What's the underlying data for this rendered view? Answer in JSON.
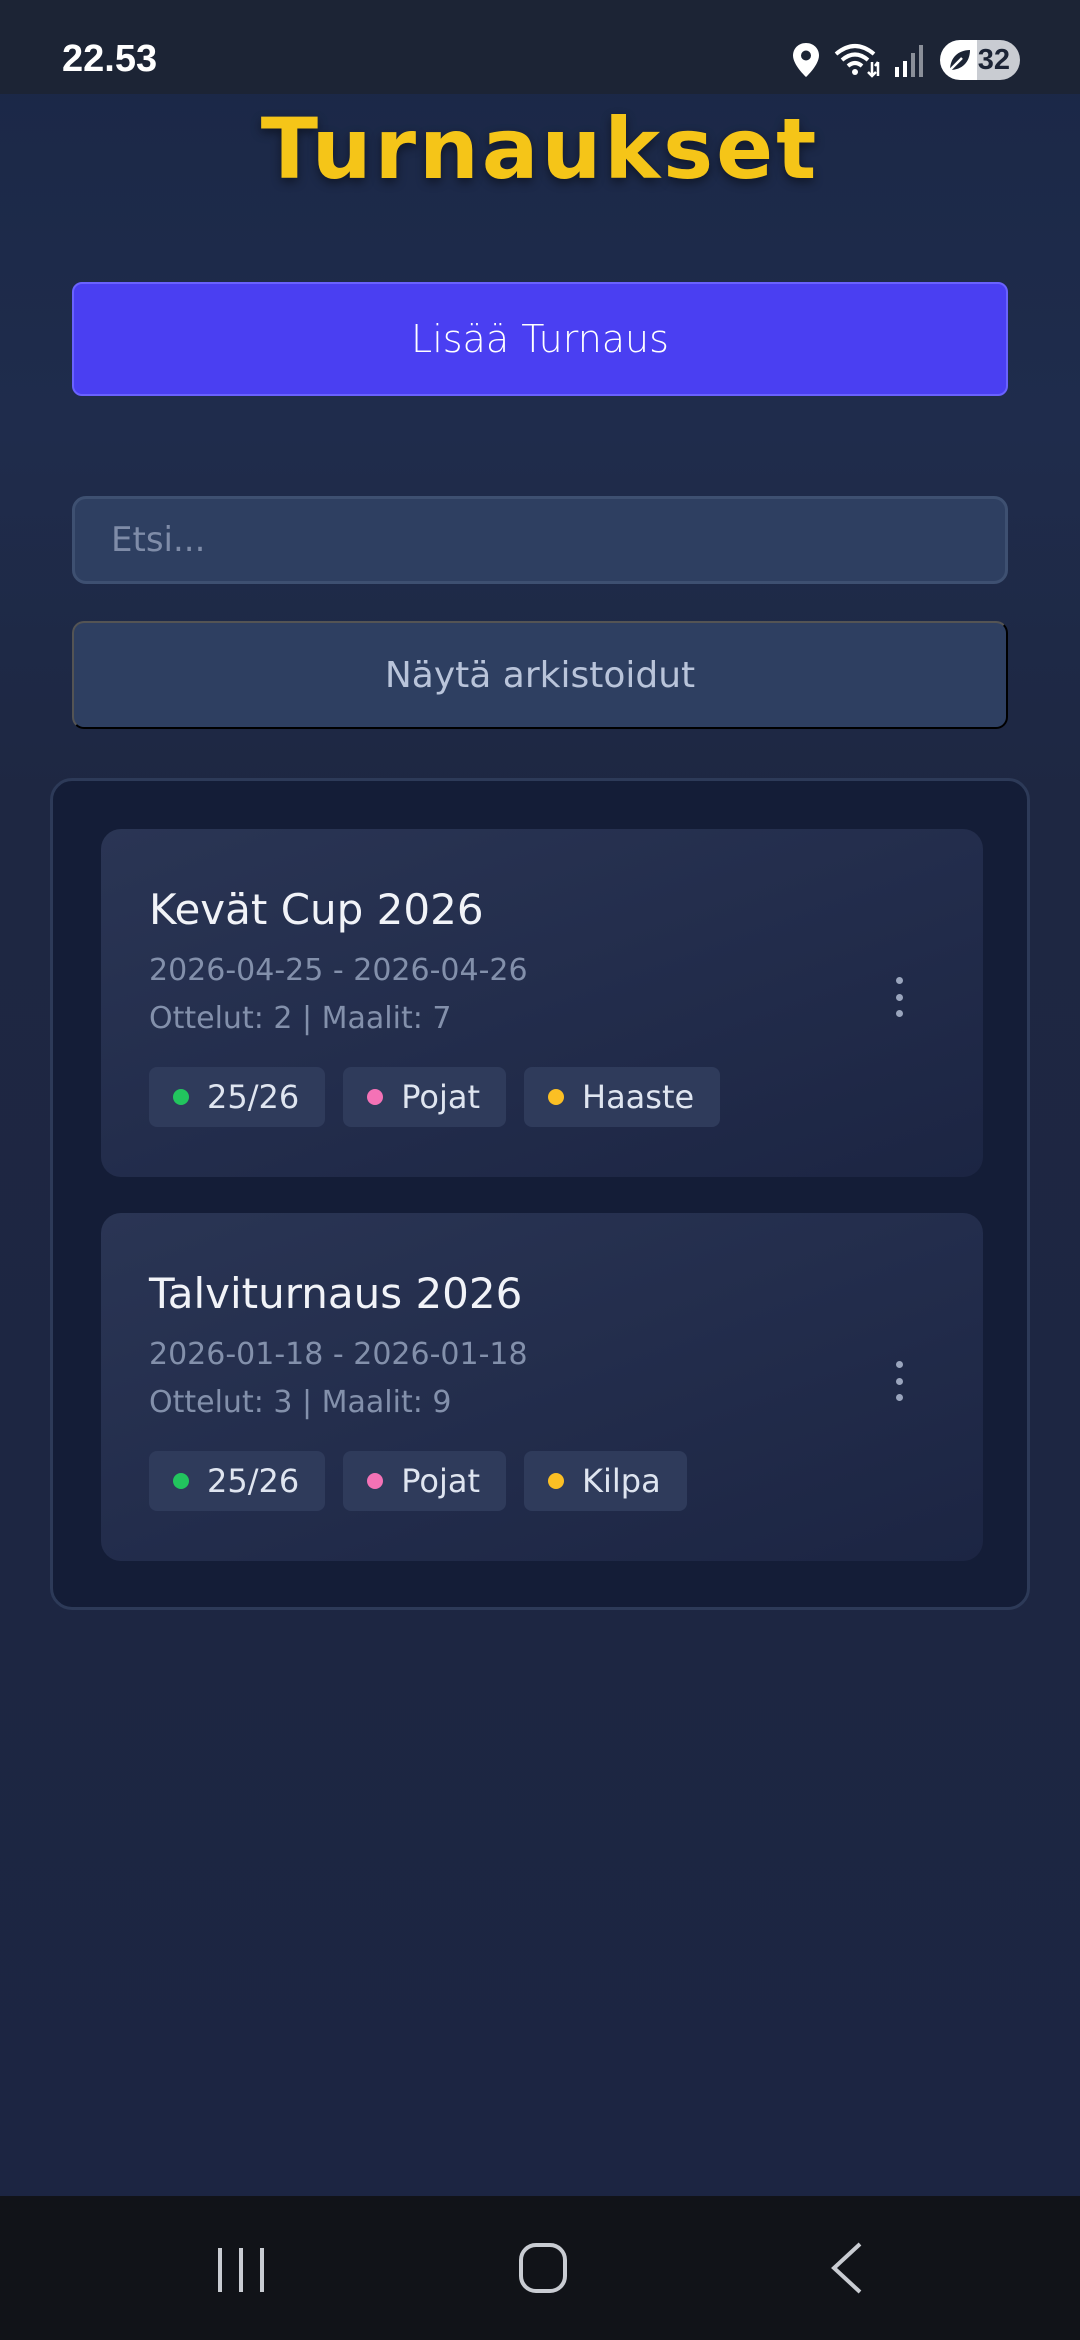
{
  "status_bar": {
    "time": "22.53",
    "battery_level": "32",
    "icons": [
      "location-icon",
      "wifi-icon",
      "signal-icon",
      "battery-icon"
    ]
  },
  "page": {
    "title": "Turnaukset",
    "add_button_label": "Lisää Turnaus",
    "search_placeholder": "Etsi...",
    "archive_toggle_label": "Näytä arkistoidut"
  },
  "tournaments": [
    {
      "name": "Kevät Cup 2026",
      "dates": "2026-04-25 - 2026-04-26",
      "stats": "Ottelut: 2 | Maalit: 7",
      "tags": [
        {
          "label": "25/26",
          "color": "#22c55e"
        },
        {
          "label": "Pojat",
          "color": "#f472b6"
        },
        {
          "label": "Haaste",
          "color": "#fbbf24"
        }
      ]
    },
    {
      "name": "Talviturnaus 2026",
      "dates": "2026-01-18 - 2026-01-18",
      "stats": "Ottelut: 3 | Maalit: 9",
      "tags": [
        {
          "label": "25/26",
          "color": "#22c55e"
        },
        {
          "label": "Pojat",
          "color": "#f472b6"
        },
        {
          "label": "Kilpa",
          "color": "#fbbf24"
        }
      ]
    }
  ],
  "colors": {
    "title": "#f5c518",
    "primary_button": "#4a3ff2",
    "background": "#1e2742"
  },
  "nav_bar": {
    "icons": [
      "recent-apps-icon",
      "home-icon",
      "back-icon"
    ]
  }
}
